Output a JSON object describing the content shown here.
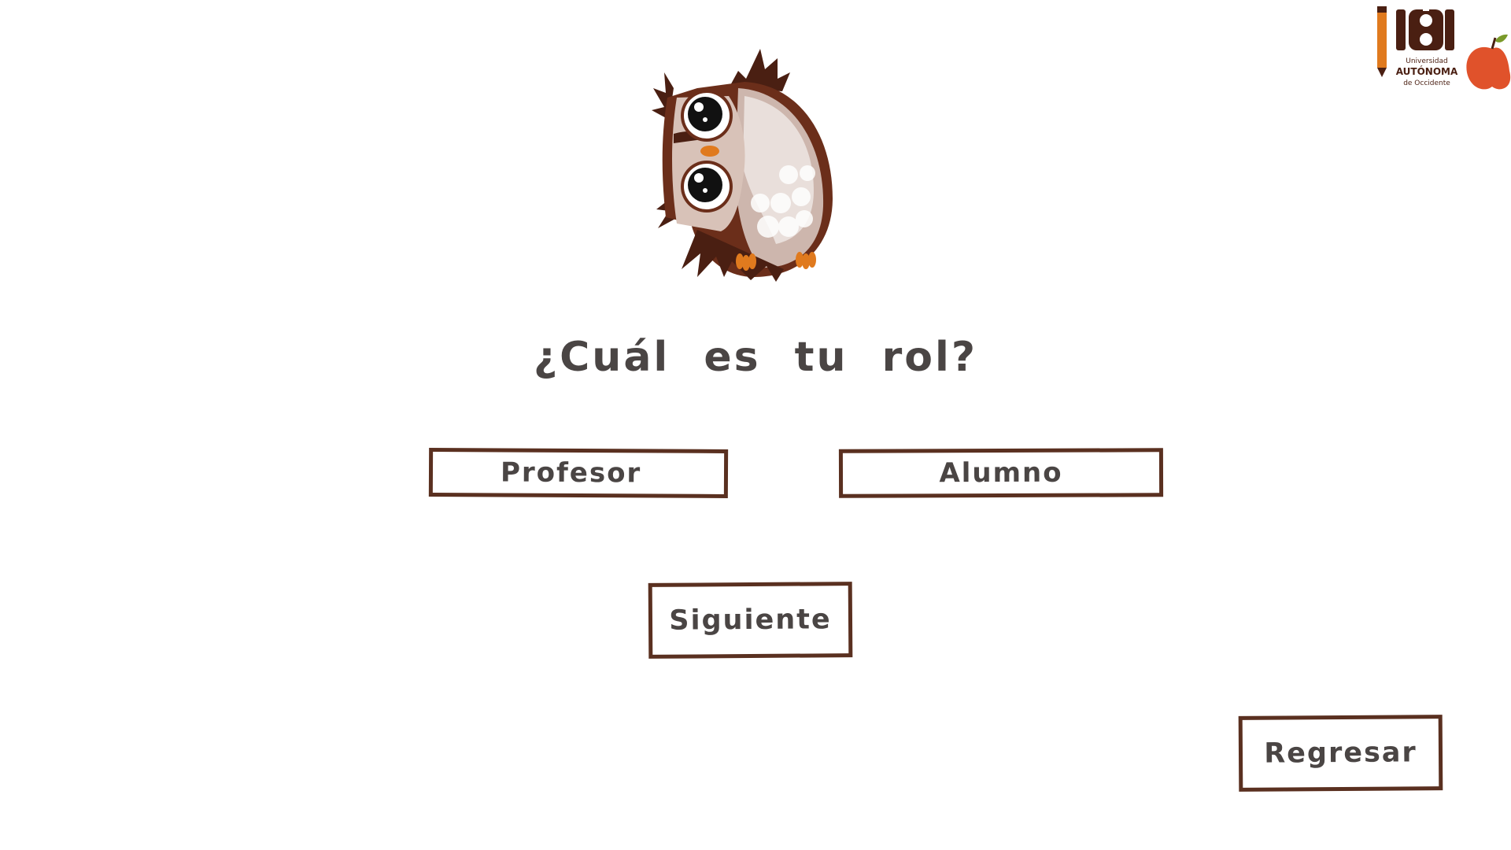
{
  "question": "¿Cuál es tu rol?",
  "roles": {
    "profesor_label": "Profesor",
    "alumno_label": "Alumno"
  },
  "navigation": {
    "next_label": "Siguiente",
    "back_label": "Regresar"
  },
  "logo": {
    "line1": "Universidad",
    "line2": "AUTÓNOMA",
    "line3": "de Occidente"
  },
  "colors": {
    "button_border": "#5a3020",
    "text": "#4a4544",
    "background": "#ffffff",
    "owl_dark": "#4a1f12",
    "owl_brown": "#6b2e1a",
    "owl_cream": "#e9dfdb",
    "owl_beak": "#e07a1e"
  },
  "icons": [
    "owl-mascot-icon",
    "university-logo"
  ]
}
